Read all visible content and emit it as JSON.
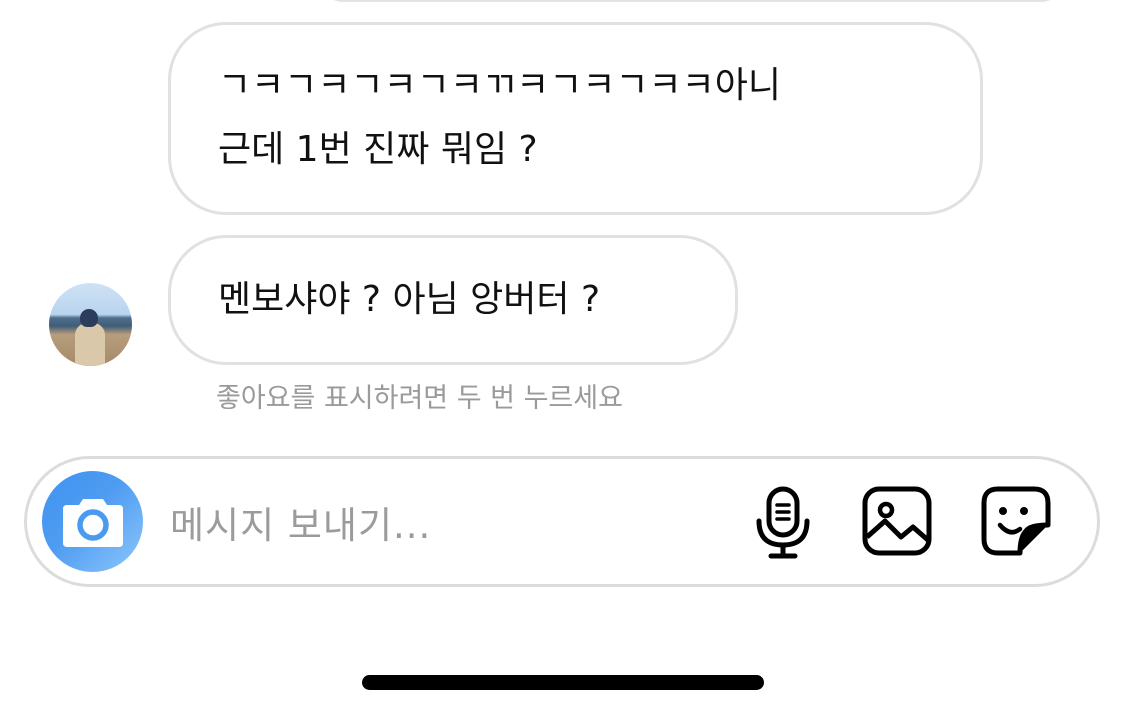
{
  "messages": [
    {
      "lines": [
        "ㄱㅋㄱㅋㄱㅋㄱㅋㄲㅋㄱㅋㄱㅋㅋ아니",
        "근데 1번 진짜 뭐임 ?"
      ]
    },
    {
      "lines": [
        "멘보샤야 ? 아님 앙버터 ?"
      ]
    }
  ],
  "like_hint": "좋아요를 표시하려면 두 번 누르세요",
  "composer": {
    "placeholder": "메시지 보내기...",
    "icons": [
      "camera-icon",
      "microphone-icon",
      "image-icon",
      "sticker-icon"
    ]
  },
  "colors": {
    "camera_button_start": "#3e93f0",
    "camera_button_end": "#8ec7fb",
    "bubble_border": "#e1e1e1",
    "hint_text": "#9a9a9a"
  }
}
